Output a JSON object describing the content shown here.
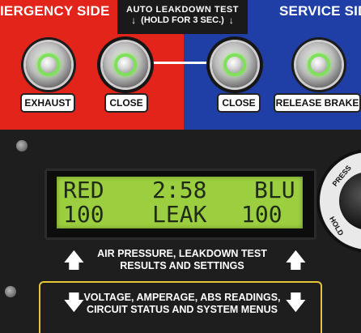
{
  "panel": {
    "emergency_title": "IERGENCY SIDE",
    "service_title": "SERVICE SIDE",
    "auto_test_line1": "AUTO LEAKDOWN TEST",
    "auto_test_line2": "(HOLD FOR 3 SEC.)"
  },
  "buttons": [
    {
      "label": "EXHAUST"
    },
    {
      "label": "CLOSE"
    },
    {
      "label": "CLOSE"
    },
    {
      "label": "RELEASE BRAKE"
    }
  ],
  "lcd": {
    "r1_left": "RED",
    "r1_mid": "2:58",
    "r1_right": "BLU",
    "r2_left": "100",
    "r2_mid": "LEAK",
    "r2_right": "100",
    "backlight_color": "#9ccf3f"
  },
  "knob": {
    "text_top": "PRESS",
    "text_side": "HOLD"
  },
  "info": {
    "upper_line1": "AIR PRESSURE, LEAKDOWN TEST",
    "upper_line2": "RESULTS AND SETTINGS",
    "lower_line1": "VOLTAGE, AMPERAGE, ABS READINGS,",
    "lower_line2": "CIRCUIT STATUS AND SYSTEM MENUS"
  },
  "colors": {
    "emergency_red": "#e3241b",
    "service_blue": "#1f3fa6",
    "indicator_green": "#7fe05a",
    "menu_border_yellow": "#e6c53a"
  }
}
